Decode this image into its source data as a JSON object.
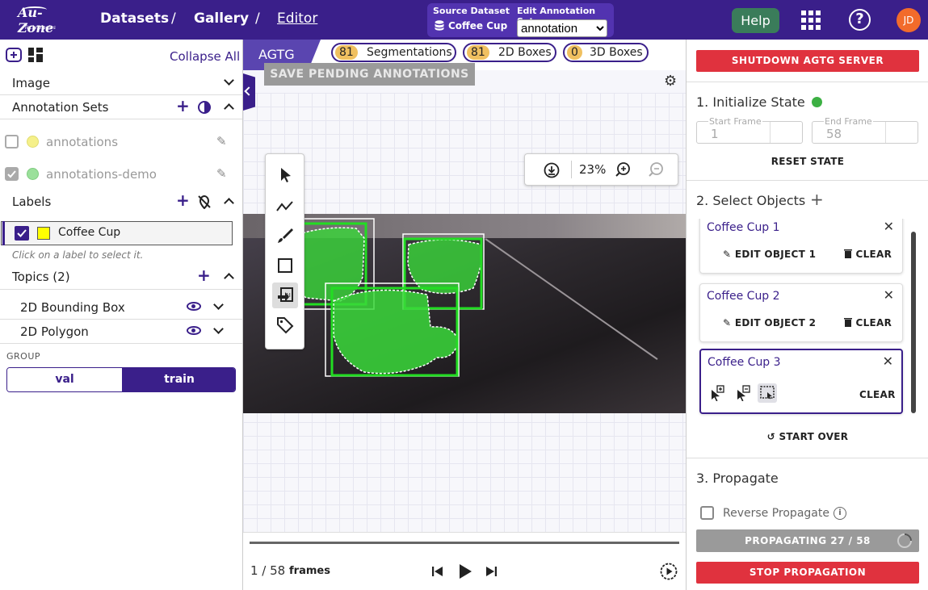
{
  "header": {
    "logo_main": "Au-Zone",
    "logo_sub": "Technologies",
    "breadcrumb": [
      "Datasets",
      "Gallery",
      "Editor"
    ],
    "separator": "/",
    "source_dataset_label": "Source Dataset",
    "source_dataset_value": "Coffee Cup",
    "edit_annotation_label": "Edit Annotation Set",
    "edit_annotation_value": "annotation",
    "help_label": "Help",
    "avatar_initials": "JD"
  },
  "left": {
    "collapse_all": "Collapse All",
    "image_label": "Image",
    "annotation_sets_label": "Annotation Sets",
    "annotation_sets": [
      {
        "name": "annotations",
        "checked": false,
        "color": "#f5f08a"
      },
      {
        "name": "annotations-demo",
        "checked": true,
        "color": "#9be09b"
      }
    ],
    "labels_label": "Labels",
    "label_item": "Coffee Cup",
    "label_color": "#ffff00",
    "label_hint": "Click on a label to select it.",
    "topics_label": "Topics (2)",
    "topics": [
      "2D Bounding Box",
      "2D Polygon"
    ],
    "group_label": "GROUP",
    "group_options": [
      "val",
      "train"
    ],
    "group_selected": "train"
  },
  "center": {
    "tab_label": "AGTG",
    "chips": [
      {
        "count": "81",
        "label": "Segmentations"
      },
      {
        "count": "81",
        "label": "2D Boxes"
      },
      {
        "count": "0",
        "label": "3D Boxes"
      }
    ],
    "save_label": "SAVE PENDING ANNOTATIONS",
    "zoom": "23%",
    "frame_position": "1 / 58",
    "frames_label": "frames",
    "accent_color": "#3a1f8a",
    "mask_color": "#3ad83a"
  },
  "right": {
    "shutdown_label": "SHUTDOWN AGTG SERVER",
    "s1_title": "1. Initialize State",
    "start_frame_label": "Start Frame",
    "start_frame_value": "1",
    "end_frame_label": "End Frame",
    "end_frame_value": "58",
    "reset_label": "RESET STATE",
    "s2_title": "2. Select Objects",
    "objects": [
      {
        "name": "Coffee Cup 1",
        "edit": "EDIT OBJECT 1",
        "clear": "CLEAR"
      },
      {
        "name": "Coffee Cup 2",
        "edit": "EDIT OBJECT 2",
        "clear": "CLEAR"
      },
      {
        "name": "Coffee Cup 3",
        "clear": "CLEAR"
      }
    ],
    "start_over": "START OVER",
    "s3_title": "3. Propagate",
    "reverse_label": "Reverse Propagate",
    "propagating_label": "PROPAGATING 27 / 58",
    "stop_label": "STOP PROPAGATION",
    "status_color": "#3cb043",
    "danger_color": "#e0323e"
  }
}
